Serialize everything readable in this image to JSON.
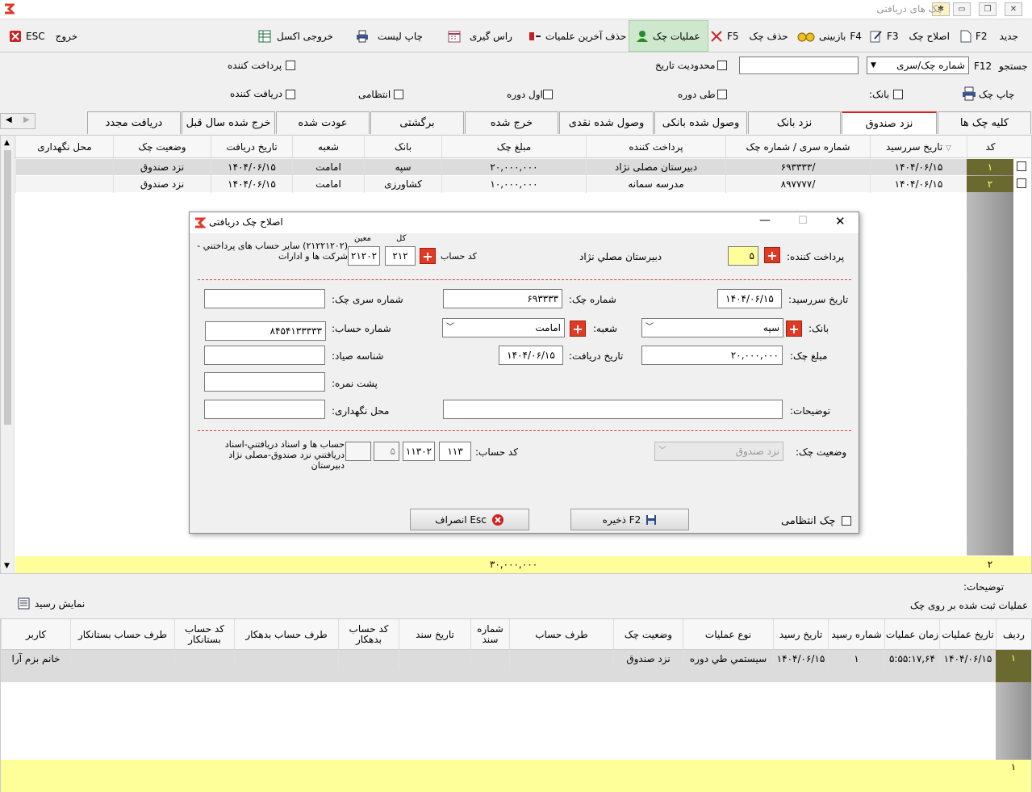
{
  "window": {
    "title": "چک های دریافتی"
  },
  "toolbar": {
    "new_key": "F2",
    "new_label": "جدید",
    "edit_key": "F3",
    "edit_label": "اصلاح چک",
    "review_key": "F4",
    "review_label": "بازبینی",
    "delete_key": "F5",
    "delete_label": "حذف چک",
    "ops_label": "عملیات چک",
    "delete_last_label": "حذف آخرین علمیات",
    "due_label": "راس گیری",
    "print_list_label": "چاپ لیست",
    "excel_label": "خروجی اکسل",
    "exit_key": "ESC",
    "exit_label": "خروج"
  },
  "search": {
    "label": "جستجو",
    "key": "F12",
    "type_value": "شماره چک/سری",
    "text_value": "",
    "date_limit_label": "محدودیت تاریخ",
    "payer_label": "پرداخت کننده",
    "print_check_label": "چاپ چک",
    "bank_label": "بانک:",
    "period_label": "طی دوره",
    "first_period_label": "اول دوره",
    "regular_label": "انتظامی",
    "receiver_label": "دریافت کننده"
  },
  "tabs": [
    "کلیه چک ها",
    "نزد صندوق",
    "نزد بانک",
    "وصول شده بانکی",
    "وصول شده نقدی",
    "خرج شده",
    "برگشتی",
    "عودت شده",
    "خرج شده سال قبل",
    "دریافت مجدد"
  ],
  "grid": {
    "headers": [
      "کد",
      "تاریخ سررسید",
      "شماره سری / شماره چک",
      "پرداخت کننده",
      "مبلغ چک",
      "بانک",
      "شعبه",
      "تاریخ دریافت",
      "وضعیت چک",
      "محل نگهداری"
    ],
    "rows": [
      [
        "۱",
        "۱۴۰۴/۰۶/۱۵",
        "۶۹۳۳۳۳/",
        "دبیرستان مصلی نژاد",
        "۲۰,۰۰۰,۰۰۰",
        "سپه",
        "امامت",
        "۱۴۰۴/۰۶/۱۵",
        "نزد صندوق",
        ""
      ],
      [
        "۲",
        "۱۴۰۴/۰۶/۱۵",
        "۸۹۷۷۷۷/",
        "مدرسه سمانه",
        "۱۰,۰۰۰,۰۰۰",
        "کشاورزی",
        "امامت",
        "۱۴۰۴/۰۶/۱۵",
        "نزد صندوق",
        ""
      ]
    ],
    "footer_count": "۲",
    "footer_total": "۳۰,۰۰۰,۰۰۰"
  },
  "dialog": {
    "title": "اصلاح چک دریافتی",
    "payer_label": "پرداخت کننده:",
    "payer_code": "۵",
    "payer_name": "دبیرستان مصلي نژاد",
    "account_code_label": "کد حساب",
    "kol_label": "کل",
    "kol_value": "۲۱۲",
    "moein_label": "معین",
    "moein_value": "۲۱۲۰۲",
    "account_desc": "(۲۱۲۲۱۲۰۲) سایر حساب های پرداختني - شرکت ها و ادارات",
    "due_date_label": "تاریخ سررسید:",
    "due_date_value": "۱۴۰۴/۰۶/۱۵",
    "check_no_label": "شماره چک:",
    "check_no_value": "۶۹۳۳۳۳",
    "series_label": "شماره سری چک:",
    "series_value": "",
    "bank_label": "بانک:",
    "bank_value": "سپه",
    "branch_label": "شعبه:",
    "branch_value": "امامت",
    "account_no_label": "شماره حساب:",
    "account_no_value": "۸۴۵۴۱۳۳۳۳۳",
    "amount_label": "مبلغ چک:",
    "amount_value": "۲۰,۰۰۰,۰۰۰",
    "receive_date_label": "تاریخ دریافت:",
    "receive_date_value": "۱۴۰۴/۰۶/۱۵",
    "sayad_label": "شناسه صیاد:",
    "sayad_value": "",
    "back_no_label": "پشت نمره:",
    "back_no_value": "",
    "desc_label": "توضیحات:",
    "desc_value": "",
    "storage_label": "محل نگهداری:",
    "storage_value": "",
    "status_label": "وضعیت چک:",
    "status_value": "نزد صندوق",
    "acc_code_label": "کد حساب:",
    "acc_code_1": "۱۱۳",
    "acc_code_2": "۱۱۳۰۲",
    "acc_code_3": "۵",
    "acc_code_4": "",
    "acc_code_desc": "حساب ها و اسناد دریافتني-اسناد دریافتني نزد صندوق-مصلی نژاد دبیرستان",
    "regular_label": "چک انتظامی",
    "save_label": "ذخیره F2",
    "cancel_label": "انصراف Esc"
  },
  "lower": {
    "desc_label": "توضیحات:",
    "ops_title": "عملیات ثبت شده بر روی چک",
    "show_receipt_label": "نمایش رسید",
    "headers": [
      "ردیف",
      "تاریخ عملیات",
      "زمان عملیات",
      "شماره رسید",
      "تاریخ رسید",
      "نوع عملیات",
      "وضعیت چک",
      "طرف حساب",
      "شماره سند",
      "تاریخ سند",
      "کد حساب بدهکار",
      "طرف حساب بدهکار",
      "کد حساب بستانکار",
      "طرف حساب بستانکار",
      "کاربر"
    ],
    "row": [
      "۱",
      "۱۴۰۴/۰۶/۱۵",
      "۵:۵۵:۱۷,۶۴",
      "۱",
      "۱۴۰۴/۰۶/۱۵",
      "سیستمي طي دوره",
      "نزد صندوق",
      "",
      "",
      "",
      "",
      "",
      "",
      "",
      "خانم بزم آرا"
    ],
    "footer_count": "۱"
  },
  "colors": {
    "accent_red": "#e03a25",
    "yellow_row": "#ffff99",
    "selected_row": "#dcdcdc"
  }
}
